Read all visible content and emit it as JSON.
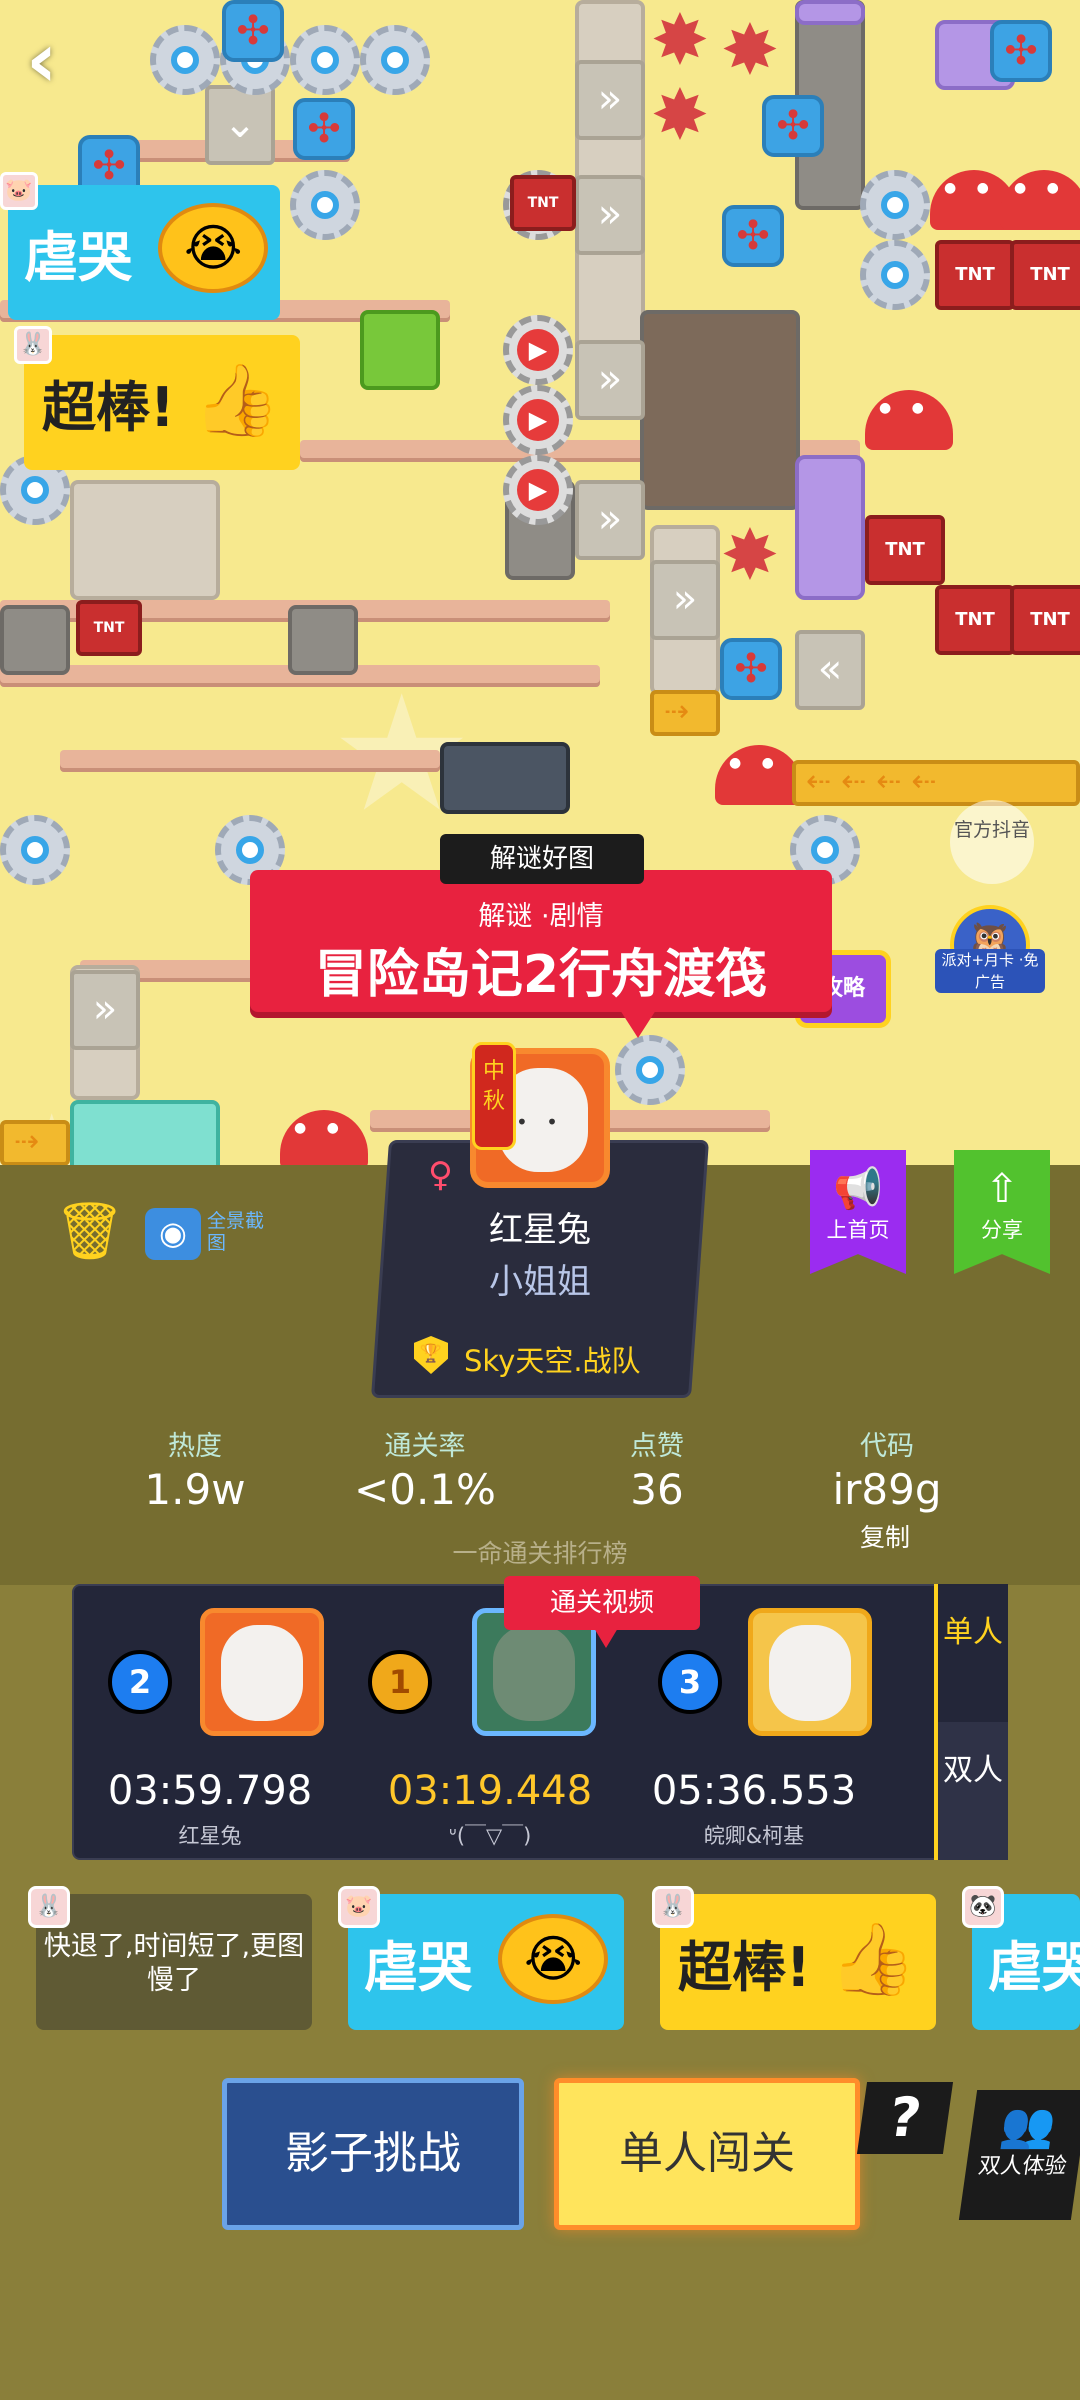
{
  "nav": {
    "back_icon": "chevron-left-icon"
  },
  "banner": {
    "tag": "解谜好图",
    "subtitle": "解谜 ·剧情",
    "title": "冒险岛记2行舟渡筏"
  },
  "side": {
    "official_douyin": "官方抖音",
    "ad_badge": "派对+月卡 ·免广告",
    "guide_tv": "攻略"
  },
  "author": {
    "lantern": "中秋",
    "name": "红星兔",
    "title": "小姐姐",
    "team": "Sky天空.战队",
    "gender_icon": "female-icon"
  },
  "tools": {
    "panorama": "全景截图",
    "home": "上首页",
    "share": "分享"
  },
  "stats": [
    {
      "label": "热度",
      "value": "1.9w"
    },
    {
      "label": "通关率",
      "value": "<0.1%"
    },
    {
      "label": "点赞",
      "value": "36"
    },
    {
      "label": "代码",
      "value": "ir89g"
    }
  ],
  "copy_label": "复制",
  "rank_title": "一命通关排行榜",
  "video_tag": "通关视频",
  "leaderboard": [
    {
      "rank": "2",
      "time": "03:59.798",
      "name": "红星兔"
    },
    {
      "rank": "1",
      "time": "03:19.448",
      "name": "ᐡ(￣▽￣)"
    },
    {
      "rank": "3",
      "time": "05:36.553",
      "name": "皖卿&柯基"
    }
  ],
  "mode_tabs": {
    "single": "单人",
    "double": "双人"
  },
  "stickers": {
    "cry": "虐哭",
    "great": "超棒!"
  },
  "comment": "快退了,时间短了,更图慢了",
  "buttons": {
    "shadow": "影子挑战",
    "solo": "单人闯关",
    "help": "?",
    "duo": "双人体验"
  },
  "colors": {
    "banner_red": "#e8223f",
    "gold": "#ffc72a",
    "board_bg": "#232639",
    "solo_yellow": "#ffe45c",
    "shadow_blue": "#2a4f8f"
  }
}
